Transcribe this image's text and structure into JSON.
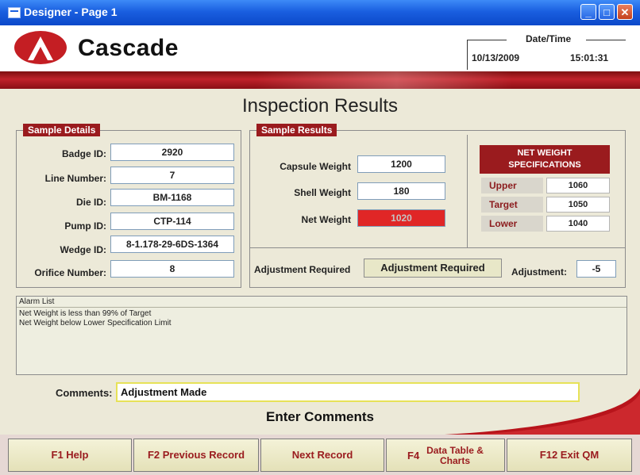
{
  "window": {
    "title": "Designer - Page 1",
    "controls": {
      "minimize": "_",
      "maximize": "□",
      "close": "✕"
    }
  },
  "header": {
    "brand": "Cascade",
    "datetime_label": "Date/Time",
    "date": "10/13/2009",
    "time": "15:01:31"
  },
  "page_title": "Inspection Results",
  "sample_details": {
    "title": "Sample Details",
    "fields": [
      {
        "label": "Badge ID:",
        "value": "2920"
      },
      {
        "label": "Line Number:",
        "value": "7"
      },
      {
        "label": "Die ID:",
        "value": "BM-1168"
      },
      {
        "label": "Pump ID:",
        "value": "CTP-114"
      },
      {
        "label": "Wedge ID:",
        "value": "8-1.178-29-6DS-1364"
      },
      {
        "label": "Orifice Number:",
        "value": "8"
      }
    ]
  },
  "sample_results": {
    "title": "Sample Results",
    "capsule_weight": {
      "label": "Capsule Weight",
      "value": "1200"
    },
    "shell_weight": {
      "label": "Shell Weight",
      "value": "180"
    },
    "net_weight": {
      "label": "Net Weight",
      "value": "1020"
    },
    "adjustment_required_label": "Adjustment Required",
    "adjustment_required_value": "Adjustment Required",
    "adjustment_label": "Adjustment:",
    "adjustment_value": "-5"
  },
  "specs": {
    "title_line1": "NET WEIGHT",
    "title_line2": "SPECIFICATIONS",
    "upper": {
      "label": "Upper",
      "value": "1060"
    },
    "target": {
      "label": "Target",
      "value": "1050"
    },
    "lower": {
      "label": "Lower",
      "value": "1040"
    }
  },
  "alarm": {
    "title": "Alarm List",
    "items": [
      "Net Weight is less than 99% of Target",
      "Net Weight below Lower Specification Limit"
    ]
  },
  "comments": {
    "label": "Comments:",
    "value": "Adjustment Made",
    "hint": "Enter Comments"
  },
  "function_keys": {
    "f1": "F1 Help",
    "f2": "F2 Previous Record",
    "next": "Next Record",
    "f4_key": "F4",
    "f4_label": "Data Table & Charts",
    "f12": "F12 Exit QM"
  },
  "colors": {
    "accent_red": "#9a1b1e",
    "net_weight_alert": "#e02626",
    "comment_border": "#e7e258"
  }
}
